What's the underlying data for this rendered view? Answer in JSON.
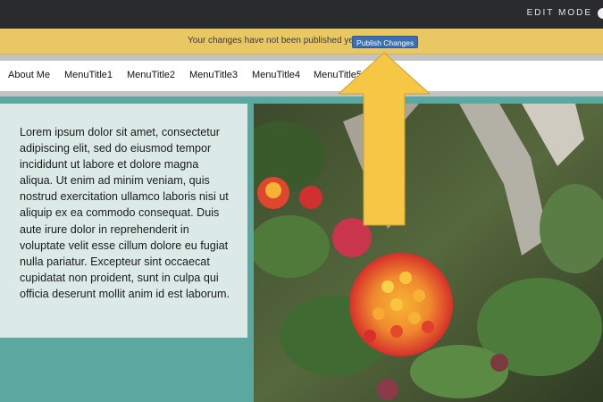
{
  "topbar": {
    "mode_label": "EDIT MODE"
  },
  "notice": {
    "message": "Your changes have not been published yet.",
    "publish_label": "Publish Changes"
  },
  "nav": {
    "items": [
      "About Me",
      "MenuTitle1",
      "MenuTitle2",
      "MenuTitle3",
      "MenuTitle4",
      "MenuTitle5"
    ]
  },
  "content": {
    "body_text": "Lorem ipsum dolor sit amet, consectetur adipiscing elit, sed do eiusmod tempor incididunt ut labore et dolore magna aliqua. Ut enim ad minim veniam, quis nostrud exercitation ullamco laboris nisi ut aliquip ex ea commodo consequat. Duis aute irure dolor in reprehenderit in voluptate velit esse cillum dolore eu fugiat nulla pariatur. Excepteur sint occaecat cupidatat non proident, sunt in culpa qui officia deserunt mollit anim id est laborum."
  },
  "colors": {
    "topbar": "#2a2b2e",
    "notice": "#e9c864",
    "publish_button": "#3d6fb0",
    "teal": "#5aa8a0",
    "text_panel": "#dceae7",
    "arrow": "#f6c744"
  },
  "icons": {
    "photo": "lantana-flower-photo",
    "arrow": "up-arrow-annotation"
  }
}
